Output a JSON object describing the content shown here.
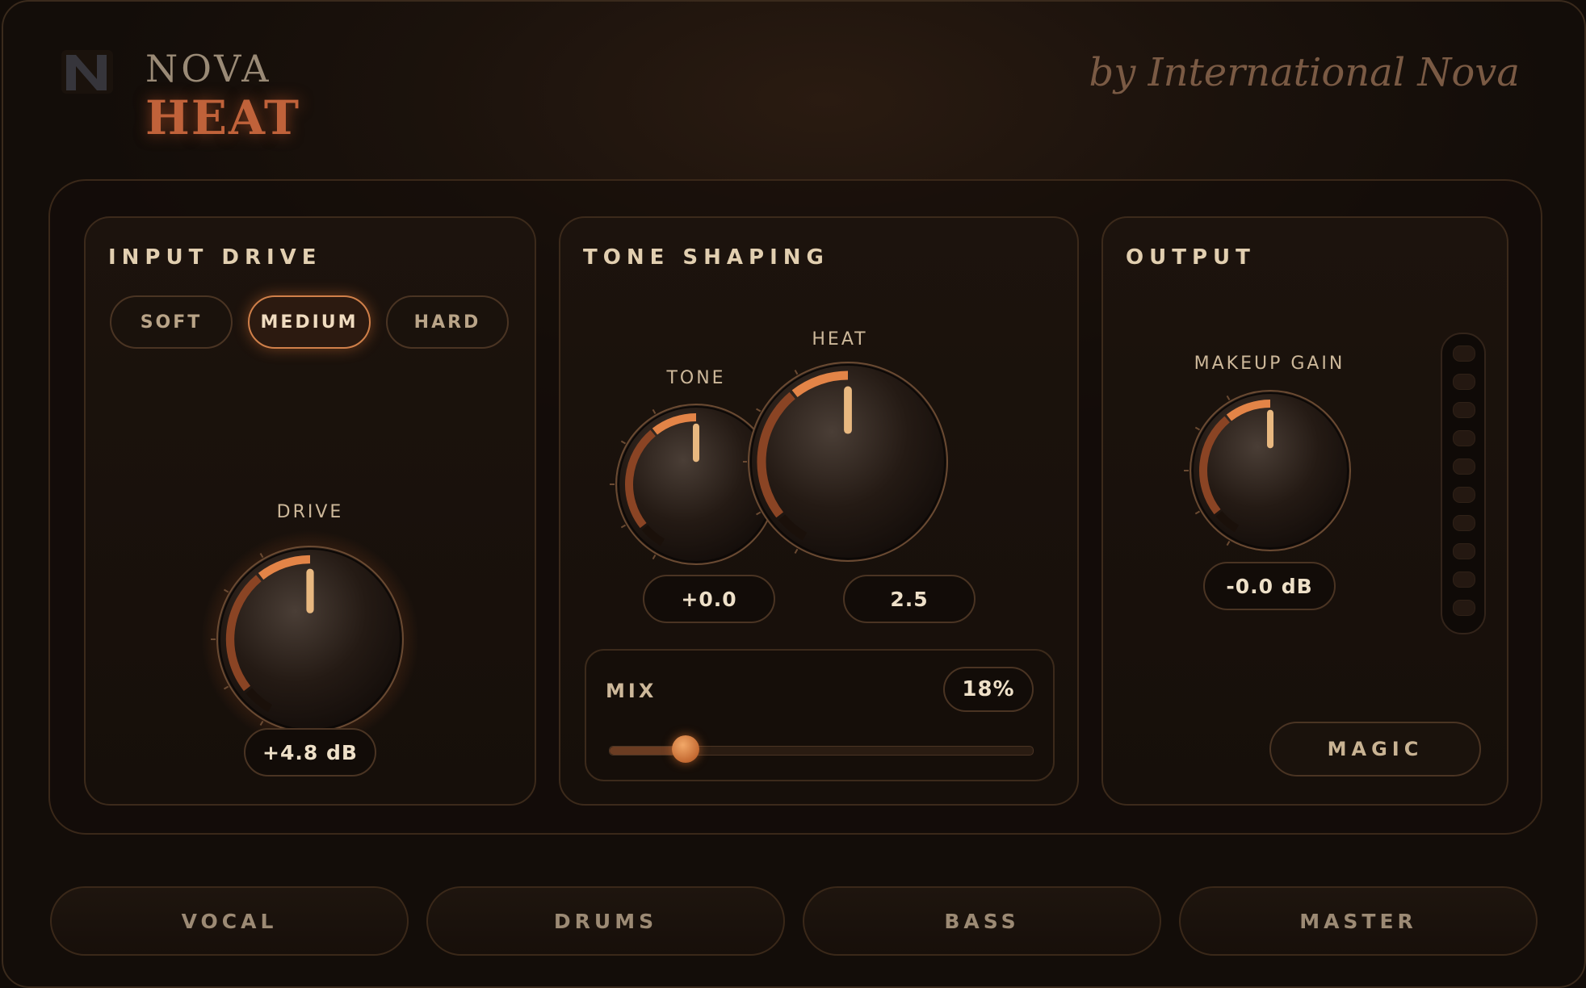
{
  "brand": {
    "logo_icon": "nova-n-logo-icon",
    "name_line1": "NOVA",
    "name_line2": "HEAT",
    "byline": "by International Nova",
    "accent_color": "#d0804a"
  },
  "input_drive": {
    "title": "INPUT DRIVE",
    "modes": [
      "SOFT",
      "MEDIUM",
      "HARD"
    ],
    "active_mode": "MEDIUM",
    "knob_label": "DRIVE",
    "readout": "+4.8 dB",
    "knob_level": 0.5
  },
  "tone_shaping": {
    "title": "TONE SHAPING",
    "tone": {
      "label": "TONE",
      "readout": "+0.0",
      "level": 0.5
    },
    "heat": {
      "label": "HEAT",
      "readout": "2.5",
      "level": 0.5
    },
    "mix": {
      "label": "MIX",
      "value": "18%",
      "fraction": 0.18
    }
  },
  "output": {
    "title": "OUTPUT",
    "knob_label": "MAKEUP GAIN",
    "readout": "-0.0 dB",
    "knob_level": 0.5,
    "meter_led_count": 10,
    "magic_label": "MAGIC"
  },
  "presets": [
    "VOCAL",
    "DRUMS",
    "BASS",
    "MASTER"
  ]
}
